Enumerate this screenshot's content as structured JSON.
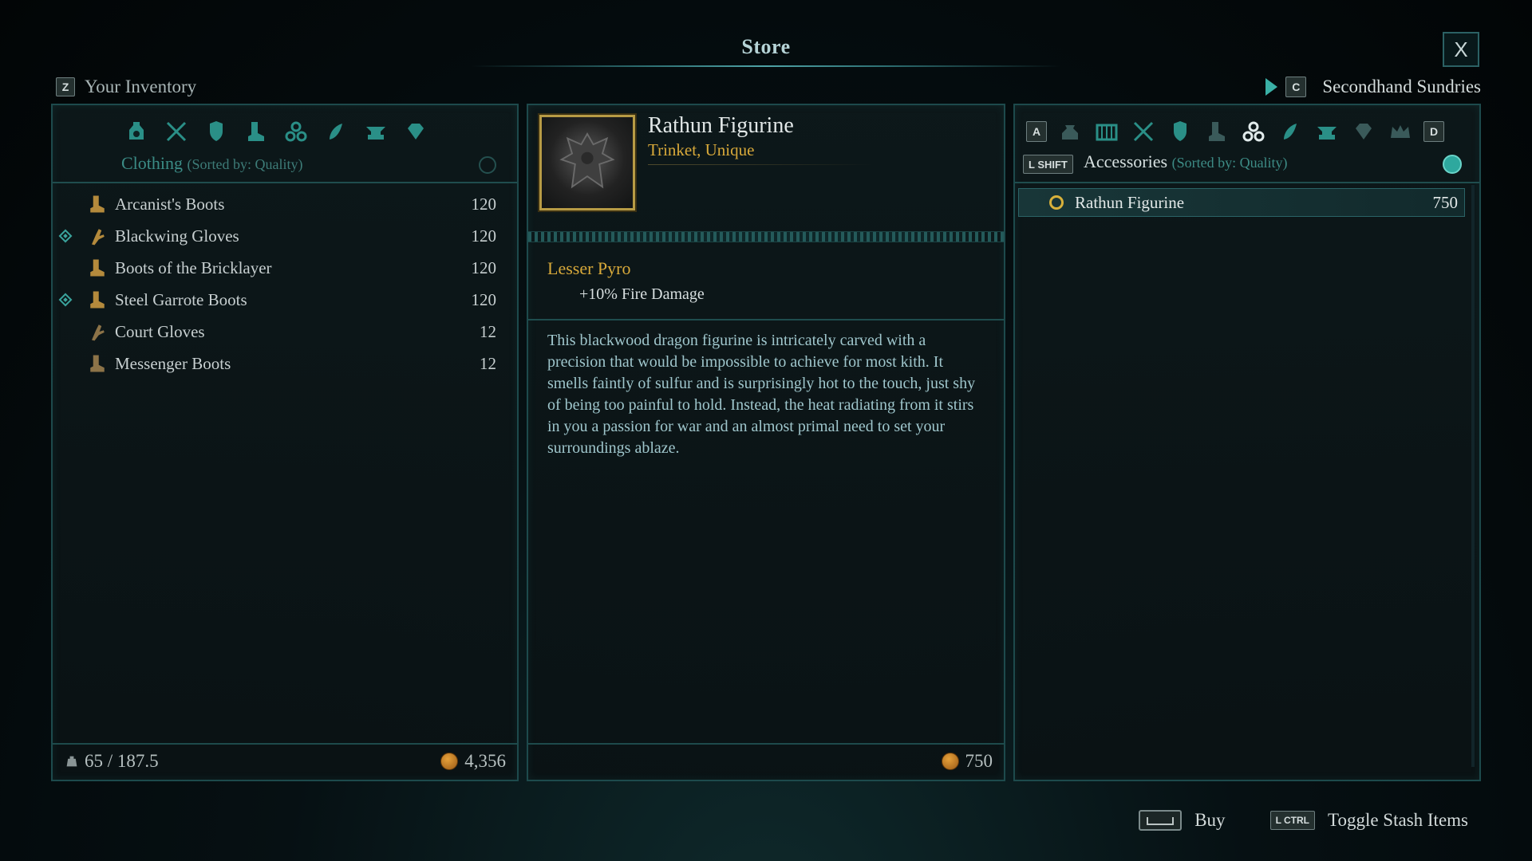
{
  "window": {
    "title": "Store",
    "close_label": "X"
  },
  "inventory_header": {
    "key": "Z",
    "label": "Your Inventory"
  },
  "vendor_header": {
    "key": "C",
    "label": "Secondhand Sundries"
  },
  "inventory": {
    "category_icons": [
      "potion-icon",
      "crossed-weapons-icon",
      "armor-icon",
      "boots-icon",
      "trinket-cluster-icon",
      "reagent-icon",
      "anvil-icon",
      "gem-icon"
    ],
    "category": "Clothing",
    "sort": "(Sorted by: Quality)",
    "items": [
      {
        "name": "Arcanist's Boots",
        "value": "120",
        "equipped": false,
        "icon": "boots-icon"
      },
      {
        "name": "Blackwing Gloves",
        "value": "120",
        "equipped": true,
        "icon": "gloves-icon"
      },
      {
        "name": "Boots of the Bricklayer",
        "value": "120",
        "equipped": false,
        "icon": "boots-icon"
      },
      {
        "name": "Steel Garrote Boots",
        "value": "120",
        "equipped": true,
        "icon": "boots-icon"
      },
      {
        "name": "Court Gloves",
        "value": "12",
        "equipped": false,
        "icon": "gloves-icon"
      },
      {
        "name": "Messenger Boots",
        "value": "12",
        "equipped": false,
        "icon": "boots-icon"
      }
    ],
    "weight": "65 / 187.5",
    "gold": "4,356"
  },
  "detail": {
    "title": "Rathun Figurine",
    "type": "Trinket, Unique",
    "perk_name": "Lesser Pyro",
    "perk_effect": "+10% Fire Damage",
    "description": "This blackwood dragon figurine is intricately carved with a precision that would be impossible to achieve for most kith. It smells faintly of sulfur and is surprisingly hot to the touch, just shy of being too painful to hold. Instead, the heat radiating from it stirs in you a passion for war and an almost primal need to set your surroundings ablaze.",
    "price": "750"
  },
  "vendor": {
    "prev_key": "A",
    "next_key": "D",
    "tab_key": "L SHIFT",
    "category_icons": [
      "pouch-icon",
      "chest-icon",
      "crossed-weapons-icon",
      "armor-icon",
      "boots-icon",
      "trinket-cluster-icon",
      "reagent-icon",
      "anvil-icon",
      "gem-icon",
      "crown-icon"
    ],
    "category": "Accessories",
    "sort": "(Sorted by: Quality)",
    "items": [
      {
        "name": "Rathun Figurine",
        "value": "750"
      }
    ]
  },
  "prompts": {
    "buy_label": "Buy",
    "stash_key": "L CTRL",
    "stash_label": "Toggle Stash Items"
  },
  "colors": {
    "accent": "#3ab0a6",
    "gold": "#d8a93a",
    "frame": "#1d4a4c"
  }
}
